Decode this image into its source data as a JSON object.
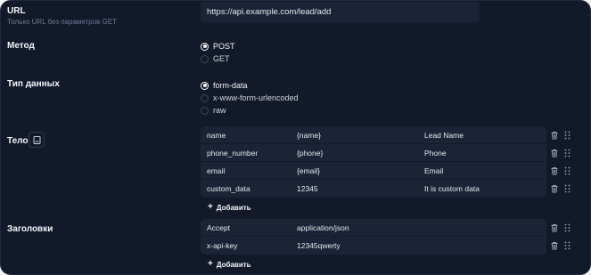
{
  "url_section": {
    "label": "URL",
    "hint": "Только URL без параметров GET",
    "value": "https://api.example.com/lead/add"
  },
  "method_section": {
    "label": "Метод",
    "options": [
      {
        "label": "POST",
        "selected": true
      },
      {
        "label": "GET",
        "selected": false
      }
    ]
  },
  "data_type_section": {
    "label": "Тип данных",
    "options": [
      {
        "label": "form-data",
        "selected": true
      },
      {
        "label": "x-www-form-urlencoded",
        "selected": false
      },
      {
        "label": "raw",
        "selected": false
      }
    ]
  },
  "body_section": {
    "label": "Тело",
    "rows": [
      {
        "key": "name",
        "value": "{name}",
        "description": "Lead Name"
      },
      {
        "key": "phone_number",
        "value": "{phone}",
        "description": "Phone"
      },
      {
        "key": "email",
        "value": "{email}",
        "description": "Email"
      },
      {
        "key": "custom_data",
        "value": "12345",
        "description": "It is custom data"
      }
    ],
    "add_label": "Добавить"
  },
  "headers_section": {
    "label": "Заголовки",
    "rows": [
      {
        "key": "Accept",
        "value": "application/json"
      },
      {
        "key": "x-api-key",
        "value": "12345qwerty"
      }
    ],
    "add_label": "Добавить"
  },
  "icons": {
    "body_editor": "document-icon",
    "delete": "trash-icon",
    "reorder": "drag-handle-icon",
    "add": "plus-icon"
  },
  "colors": {
    "background": "#121a2a",
    "field": "#1b2436",
    "text": "#e5e7eb",
    "muted": "#6b7690"
  }
}
